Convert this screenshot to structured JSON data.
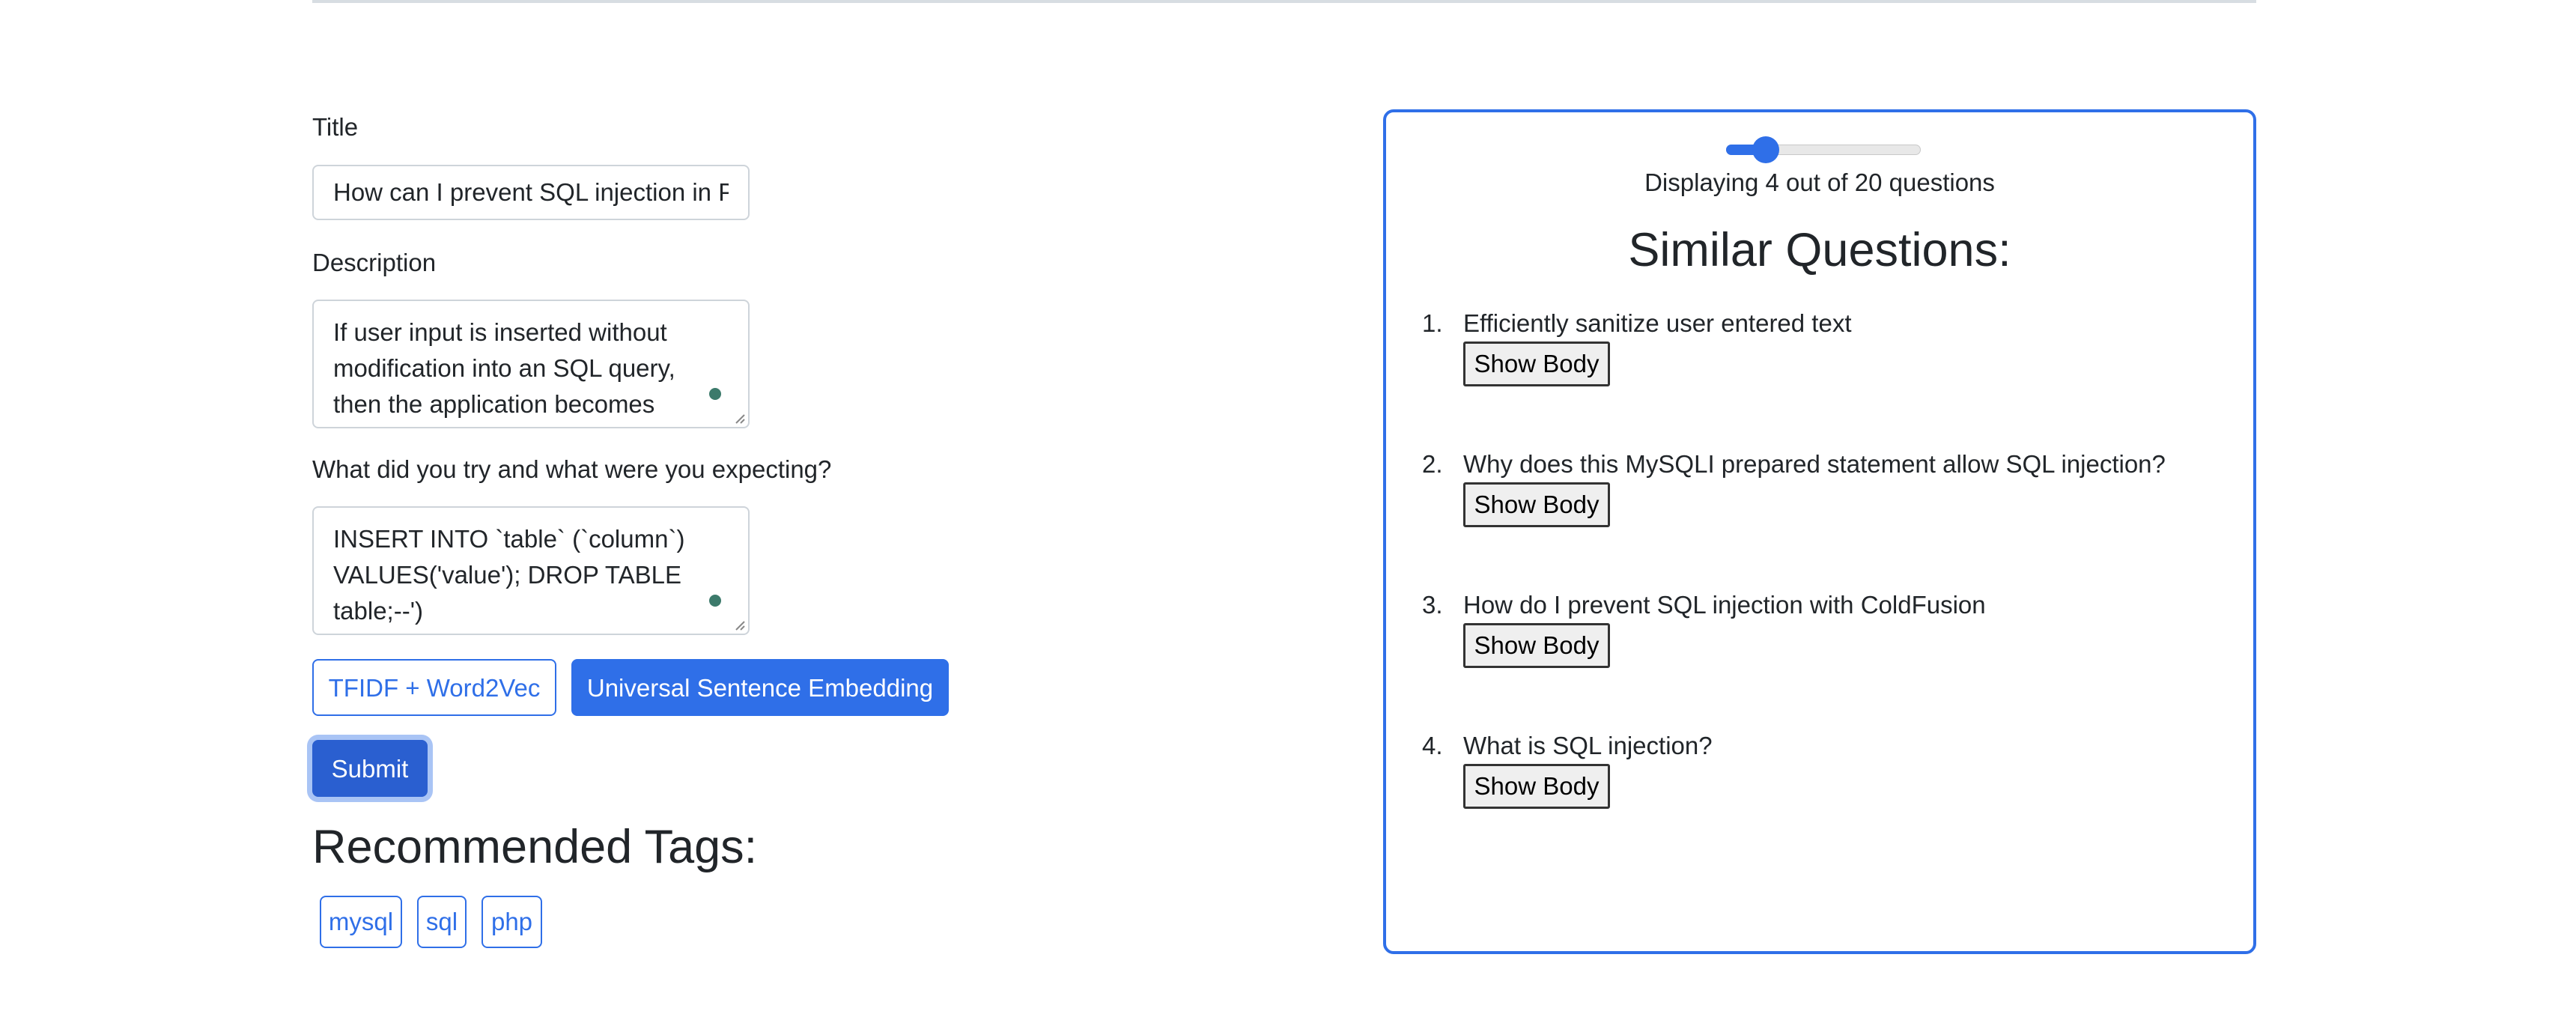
{
  "form": {
    "title_label": "Title",
    "title_value": "How can I prevent SQL injection in PHP?",
    "description_label": "Description",
    "description_value": "If user input is inserted without modification into an SQL query, then the application becomes vulnerable",
    "tried_label": "What did you try and what were you expecting?",
    "tried_value": "INSERT INTO `table` (`column`) VALUES('value'); DROP TABLE table;--')",
    "model_buttons": [
      "TFIDF + Word2Vec",
      "Universal Sentence Embedding"
    ],
    "selected_model": "Universal Sentence Embedding",
    "submit_label": "Submit"
  },
  "tags": {
    "heading": "Recommended Tags:",
    "items": [
      "mysql",
      "sql",
      "php"
    ]
  },
  "colors": {
    "accent": "#2f6fe8",
    "submit": "#2a5fd0",
    "focus_ring": "#a9c4f5",
    "text": "#212529",
    "border": "#ced4da"
  },
  "similar": {
    "slider": {
      "value": 4,
      "min": 1,
      "max": 20
    },
    "count_text": "Displaying 4 out of 20 questions",
    "heading": "Similar Questions:",
    "show_body_label": "Show Body",
    "questions": [
      {
        "number": "1.",
        "title": "Efficiently sanitize user entered text"
      },
      {
        "number": "2.",
        "title": "Why does this MySQLI prepared statement allow SQL injection?"
      },
      {
        "number": "3.",
        "title": "How do I prevent SQL injection with ColdFusion"
      },
      {
        "number": "4.",
        "title": "What is SQL injection?"
      }
    ]
  }
}
